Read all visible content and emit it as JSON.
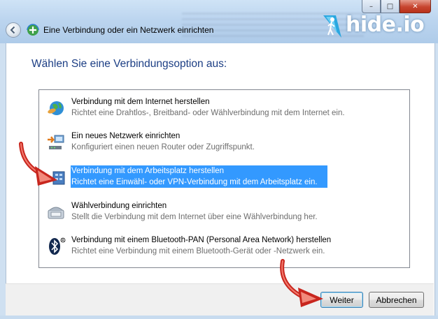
{
  "window": {
    "title": "Eine Verbindung oder ein Netzwerk einrichten",
    "controls": {
      "minimize": "–",
      "maximize": "□",
      "close": "✕"
    },
    "logo_text": "hide.io"
  },
  "heading": "Wählen Sie eine Verbindungsoption aus:",
  "options": [
    {
      "title": "Verbindung mit dem Internet herstellen",
      "desc": "Richtet eine Drahtlos-, Breitband- oder Wählverbindung mit dem Internet ein.",
      "icon": "globe-internet-icon"
    },
    {
      "title": "Ein neues Netzwerk einrichten",
      "desc": "Konfiguriert einen neuen Router oder Zugriffspunkt.",
      "icon": "new-network-icon"
    },
    {
      "title": "Verbindung mit dem Arbeitsplatz herstellen",
      "desc": "Richtet eine Einwähl- oder VPN-Verbindung mit dem Arbeitsplatz ein.",
      "icon": "workplace-vpn-icon",
      "selected": true
    },
    {
      "title": "Wählverbindung einrichten",
      "desc": "Stellt die Verbindung mit dem Internet über eine Wählverbindung her.",
      "icon": "dialup-modem-icon"
    },
    {
      "title": "Verbindung mit einem Bluetooth-PAN (Personal Area Network) herstellen",
      "desc": "Richtet eine Verbindung mit einem Bluetooth-Gerät oder -Netzwerk ein.",
      "icon": "bluetooth-icon"
    }
  ],
  "buttons": {
    "next": "Weiter",
    "cancel": "Abbrechen"
  },
  "colors": {
    "heading": "#1c3e84",
    "selection": "#3399ff",
    "annotation_arrow": "#c8261e"
  }
}
